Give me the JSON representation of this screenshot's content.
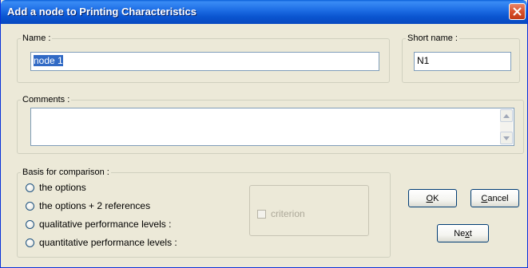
{
  "window": {
    "title": "Add a node to Printing Characteristics"
  },
  "name_group": {
    "legend": "Name :",
    "value": "node 1"
  },
  "short_name_group": {
    "legend": "Short name :",
    "value": "N1"
  },
  "comments_group": {
    "legend": "Comments :",
    "value": ""
  },
  "basis_group": {
    "legend": "Basis for comparison :",
    "options": [
      {
        "label": "the options",
        "selected": false
      },
      {
        "label": "the options + 2 references",
        "selected": false
      },
      {
        "label": "qualitative performance levels :",
        "selected": false
      },
      {
        "label": "quantitative performance levels :",
        "selected": false
      }
    ]
  },
  "criterion": {
    "label": "criterion",
    "checked": false,
    "enabled": false
  },
  "buttons": {
    "ok": {
      "mnemonic": "O",
      "rest": "K"
    },
    "cancel": {
      "mnemonic": "C",
      "rest": "ancel"
    },
    "next": {
      "pre": "Ne",
      "mnemonic": "x",
      "rest": "t"
    }
  }
}
